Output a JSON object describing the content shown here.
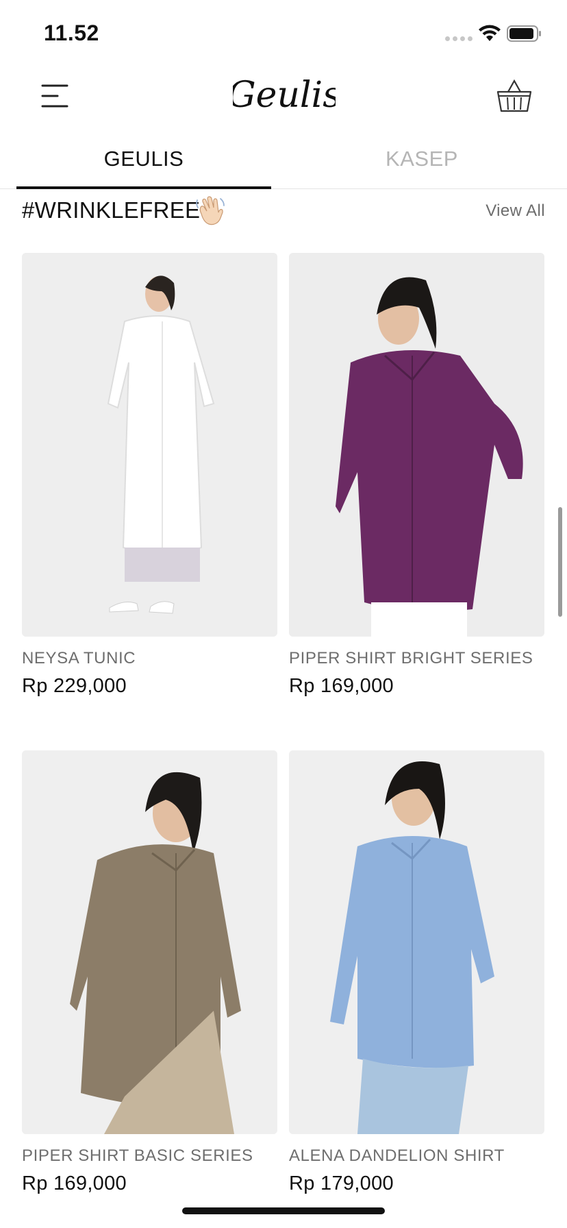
{
  "status_bar": {
    "time": "11.52"
  },
  "header": {
    "brand": "Geulis"
  },
  "tabs": [
    {
      "label": "GEULIS",
      "active": true
    },
    {
      "label": "KASEP",
      "active": false
    }
  ],
  "section": {
    "title": "#WRINKLEFREE",
    "emoji": "waving-hand-icon",
    "view_all": "View All"
  },
  "products": [
    {
      "name": "NEYSA TUNIC",
      "price": "Rp 229,000",
      "color": "#ffffff"
    },
    {
      "name": "PIPER SHIRT BRIGHT SERIES",
      "price": "Rp 169,000",
      "color": "#6b2a63"
    },
    {
      "name": "PIPER SHIRT BASIC SERIES",
      "price": "Rp 169,000",
      "color": "#8c7d68"
    },
    {
      "name": "ALENA DANDELION SHIRT",
      "price": "Rp 179,000",
      "color": "#8fb1dc"
    }
  ]
}
